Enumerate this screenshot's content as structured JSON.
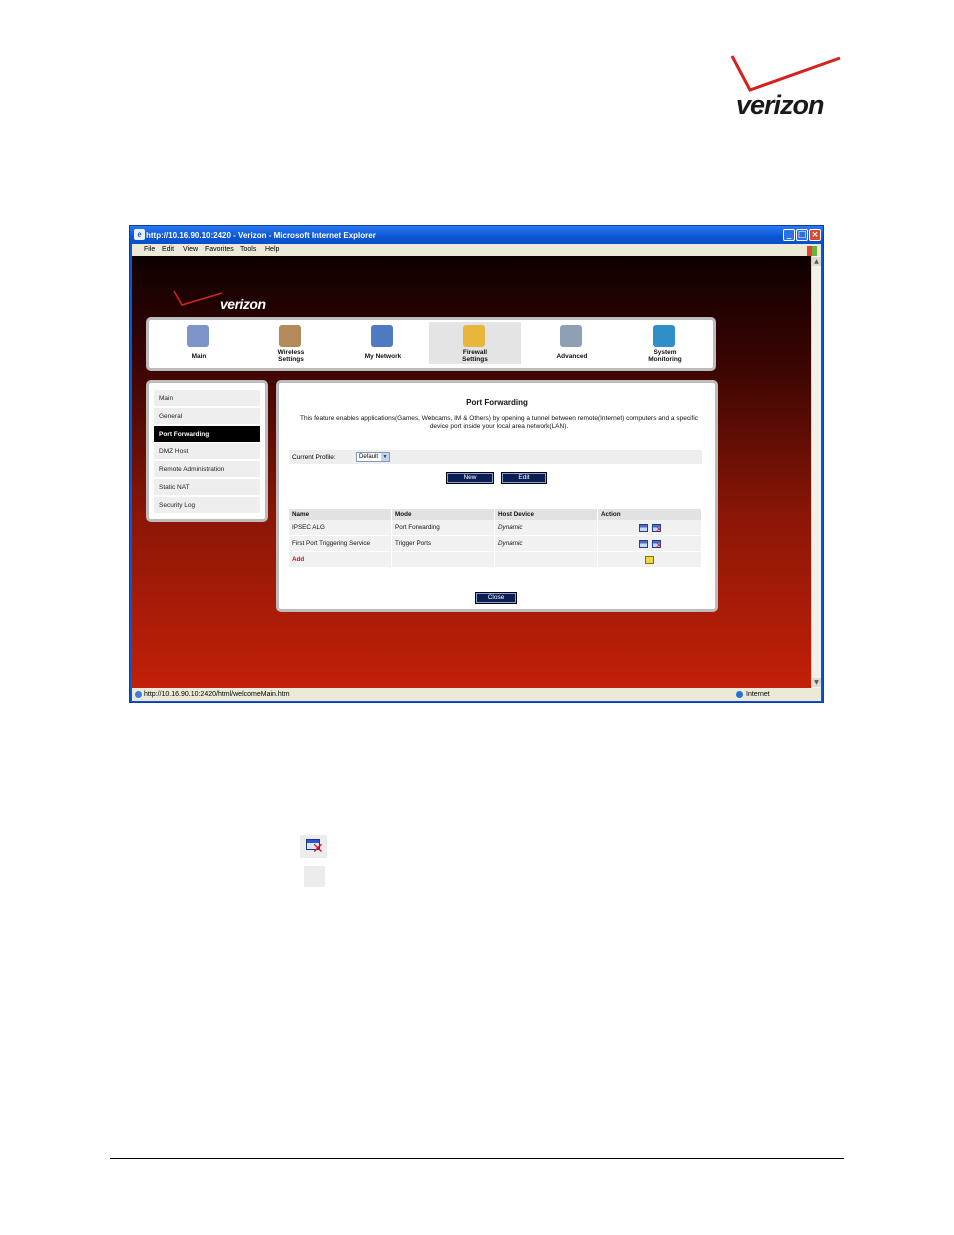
{
  "document": {
    "logo_text": "verizon"
  },
  "window": {
    "title": "http://10.16.90.10:2420 - Verizon - Microsoft Internet Explorer",
    "menu": [
      "File",
      "Edit",
      "View",
      "Favorites",
      "Tools",
      "Help"
    ],
    "status_url": "http://10.16.90.10:2420/html/welcomeMain.htm",
    "status_zone": "Internet"
  },
  "page": {
    "logo_text": "verizon",
    "nav": [
      {
        "label": "Main",
        "icon": "main-icon",
        "color": "#7f95c9"
      },
      {
        "label": "Wireless Settings",
        "icon": "wireless-icon",
        "color": "#b58a5a"
      },
      {
        "label": "My Network",
        "icon": "network-icon",
        "color": "#4f79c0"
      },
      {
        "label": "Firewall Settings",
        "icon": "firewall-icon",
        "color": "#e9b53a"
      },
      {
        "label": "Advanced",
        "icon": "advanced-icon",
        "color": "#8fa0b4"
      },
      {
        "label": "System Monitoring",
        "icon": "monitor-icon",
        "color": "#2f8fc9"
      }
    ],
    "side_menu": [
      "Main",
      "General",
      "Port Forwarding",
      "DMZ Host",
      "Remote Administration",
      "Static NAT",
      "Security Log"
    ],
    "content": {
      "title": "Port Forwarding",
      "description": "This feature enables applications(Games, Webcams, IM & Others) by opening a tunnel between remote(Internet) computers and a specific device port inside your local area network(LAN).",
      "profile_label": "Current Profile:",
      "profile_value": "Default",
      "new_label": "New",
      "edit_label": "Edit",
      "close_label": "Close",
      "columns": [
        "Name",
        "Mode",
        "Host Device",
        "Action"
      ],
      "rows": [
        {
          "name": "IPSEC ALG",
          "mode": "Port Forwarding",
          "host": "Dynamic"
        },
        {
          "name": "First Port Triggering Service",
          "mode": "Trigger Ports",
          "host": "Dynamic"
        }
      ],
      "add_label": "Add"
    }
  }
}
